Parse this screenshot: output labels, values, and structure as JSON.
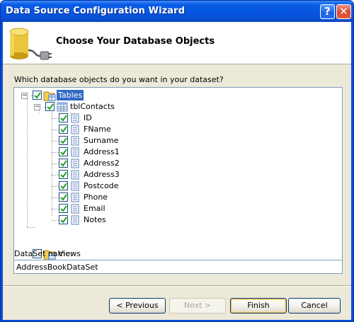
{
  "window": {
    "title": "Data Source Configuration Wizard"
  },
  "header": {
    "title": "Choose Your Database Objects",
    "icon": "database-connector-icon"
  },
  "question": "Which database objects do you want in your dataset?",
  "tree": {
    "tables": {
      "label": "Tables",
      "checked": true,
      "selected": true,
      "expanded": true
    },
    "table": {
      "label": "tblContacts",
      "checked": true,
      "expanded": true
    },
    "columns": [
      {
        "label": "ID",
        "checked": true
      },
      {
        "label": "FName",
        "checked": true
      },
      {
        "label": "Surname",
        "checked": true
      },
      {
        "label": "Address1",
        "checked": true
      },
      {
        "label": "Address2",
        "checked": true
      },
      {
        "label": "Address3",
        "checked": true
      },
      {
        "label": "Postcode",
        "checked": true
      },
      {
        "label": "Phone",
        "checked": true
      },
      {
        "label": "Email",
        "checked": true
      },
      {
        "label": "Notes",
        "checked": true
      }
    ],
    "views": {
      "label": "Views",
      "checked": false
    }
  },
  "dataset": {
    "label": "DataSet name:",
    "value": "AddressBookDataSet"
  },
  "buttons": {
    "previous": "< Previous",
    "next": "Next >",
    "finish": "Finish",
    "cancel": "Cancel"
  },
  "colors": {
    "titlebar": "#0a5ce6",
    "selection": "#316ac5",
    "dialog": "#ece9d8"
  }
}
